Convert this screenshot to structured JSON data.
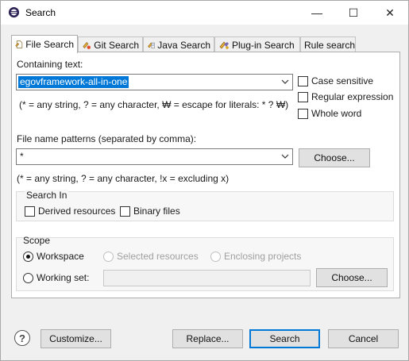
{
  "window": {
    "title": "Search",
    "minimize_label": "—",
    "maximize_label": "☐",
    "close_label": "✕"
  },
  "tabs": [
    {
      "label": "File Search",
      "icon": "file-search-icon",
      "active": true
    },
    {
      "label": "Git Search",
      "icon": "git-search-icon",
      "active": false
    },
    {
      "label": "Java Search",
      "icon": "java-search-icon",
      "active": false
    },
    {
      "label": "Plug-in Search",
      "icon": "plugin-search-icon",
      "active": false
    },
    {
      "label": "Rule search",
      "icon": "",
      "active": false
    }
  ],
  "containing_text": {
    "label": "Containing text:",
    "value": "egovframework-all-in-one",
    "hint": "(* = any string, ? = any character, ₩ = escape for literals: * ? ₩)"
  },
  "options": {
    "case_sensitive": {
      "label": "Case sensitive",
      "checked": false
    },
    "regular_expression": {
      "label": "Regular expression",
      "checked": false
    },
    "whole_word": {
      "label": "Whole word",
      "checked": false
    }
  },
  "file_patterns": {
    "label": "File name patterns (separated by comma):",
    "value": "*",
    "choose_label": "Choose...",
    "hint": "(* = any string, ? = any character, !x = excluding x)"
  },
  "search_in": {
    "title": "Search In",
    "derived_resources": {
      "label": "Derived resources",
      "checked": false
    },
    "binary_files": {
      "label": "Binary files",
      "checked": false
    }
  },
  "scope": {
    "title": "Scope",
    "workspace": {
      "label": "Workspace",
      "selected": true,
      "enabled": true
    },
    "selected_resources": {
      "label": "Selected resources",
      "selected": false,
      "enabled": false
    },
    "enclosing_projects": {
      "label": "Enclosing projects",
      "selected": false,
      "enabled": false
    },
    "working_set": {
      "label": "Working set:",
      "selected": false,
      "enabled": true,
      "value": ""
    },
    "choose_label": "Choose..."
  },
  "footer": {
    "help_label": "?",
    "customize_label": "Customize...",
    "replace_label": "Replace...",
    "search_label": "Search",
    "cancel_label": "Cancel"
  },
  "colors": {
    "selection": "#0078d7",
    "accent_border": "#0078d7",
    "window_bg": "#f0f0f0",
    "panel_bg": "#ffffff"
  }
}
